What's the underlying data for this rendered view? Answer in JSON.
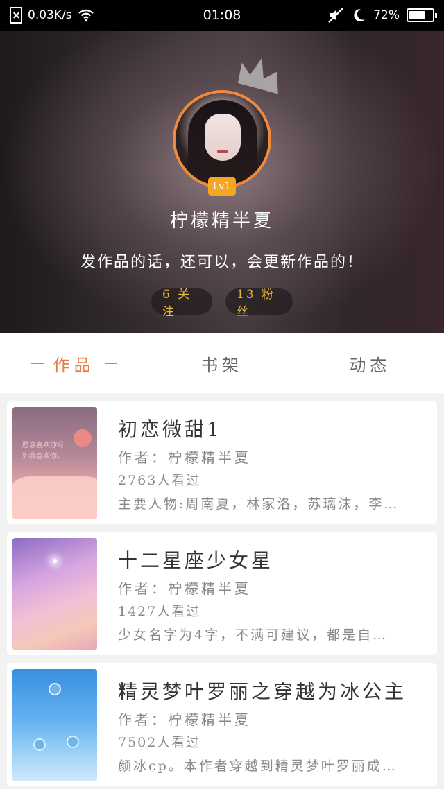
{
  "status_bar": {
    "network_speed": "0.03K/s",
    "time": "01:08",
    "battery": "72%",
    "battery_level": 0.72,
    "icons": [
      "sim-off-icon",
      "wifi-icon",
      "mute-icon",
      "moon-icon",
      "battery-icon"
    ]
  },
  "profile": {
    "level": "Lv1",
    "username": "柠檬精半夏",
    "bio": "发作品的话，还可以，会更新作品的！",
    "following": "6 关注",
    "fans": "13 粉丝"
  },
  "tabs": [
    {
      "label": "作品",
      "active": true
    },
    {
      "label": "书架",
      "active": false
    },
    {
      "label": "动态",
      "active": false
    }
  ],
  "works": [
    {
      "title": "初恋微甜1",
      "author": "作者：柠檬精半夏",
      "views": "2763人看过",
      "description": "主要人物:周南夏，林家洛，苏璃沫，李…",
      "cover_text": "愿意喜欢你呀\n如我喜欢你。"
    },
    {
      "title": "十二星座少女星",
      "author": "作者：柠檬精半夏",
      "views": "1427人看过",
      "description": "少女名字为4字，不满可建议，都是自…"
    },
    {
      "title": "精灵梦叶罗丽之穿越为冰公主",
      "author": "作者：柠檬精半夏",
      "views": "7502人看过",
      "description": "颜冰cp。本作者穿越到精灵梦叶罗丽成…"
    }
  ],
  "colors": {
    "accent": "#e87c3e",
    "badge": "#f5a623",
    "stat_text": "#e8b73a"
  }
}
